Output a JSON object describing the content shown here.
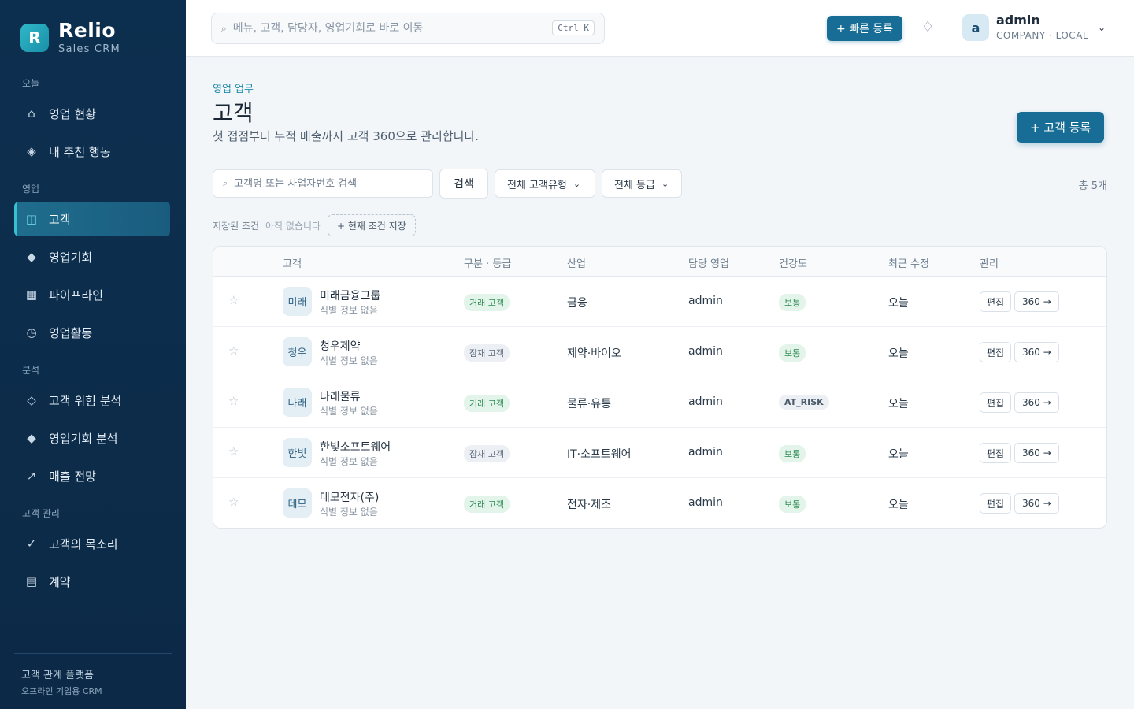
{
  "brand": {
    "logo": "R",
    "name": "Relio",
    "sub": "Sales CRM"
  },
  "sidebar": {
    "sections": [
      "오늘",
      "영업",
      "분석",
      "고객 관리"
    ],
    "items": [
      {
        "label": "영업 현황",
        "icon": "⌂"
      },
      {
        "label": "내 추천 행동",
        "icon": "◈"
      },
      {
        "label": "고객",
        "icon": "◫"
      },
      {
        "label": "영업기회",
        "icon": "◆"
      },
      {
        "label": "파이프라인",
        "icon": "▦"
      },
      {
        "label": "영업활동",
        "icon": "◷"
      },
      {
        "label": "고객 위험 분석",
        "icon": "◇"
      },
      {
        "label": "영업기회 분석",
        "icon": "◆"
      },
      {
        "label": "매출 전망",
        "icon": "↗"
      },
      {
        "label": "고객의 목소리",
        "icon": "✓"
      },
      {
        "label": "계약",
        "icon": "▤"
      }
    ],
    "footer": {
      "line1": "고객 관계 플랫폼",
      "line2": "오프라인 기업용 CRM"
    }
  },
  "topbar": {
    "search_placeholder": "메뉴, 고객, 담당자, 영업기회로 바로 이동",
    "search_icon": "⌕",
    "shortcut": "Ctrl K",
    "quick_add": "+ 빠른 등록",
    "bell_icon": "♢",
    "user": {
      "initial": "a",
      "name": "admin",
      "org": "COMPANY · LOCAL",
      "chevron": "⌄"
    }
  },
  "page": {
    "breadcrumb": "영업 업무",
    "title": "고객",
    "description": "첫 접점부터 누적 매출까지 고객 360으로 관리합니다.",
    "add_button": "+ 고객 등록"
  },
  "filters": {
    "search_placeholder": "고객명 또는 사업자번호 검색",
    "search_icon": "⌕",
    "search_button": "검색",
    "type_select": "전체 고객유형",
    "grade_select": "전체 등급",
    "chevron": "⌄",
    "total": "총 5개"
  },
  "saved": {
    "label": "저장된 조건",
    "empty": "아직 없습니다",
    "save_button": "+ 현재 조건 저장"
  },
  "table": {
    "headers": [
      "고객",
      "구분 · 등급",
      "산업",
      "담당 영업",
      "건강도",
      "최근 수정",
      "관리"
    ],
    "star": "☆",
    "edit_label": "편집",
    "view_label": "360 →",
    "rows": [
      {
        "avatar": "미래",
        "name": "미래금융그룹",
        "sub": "식별 정보 없음",
        "type": "거래 고객",
        "industry": "금융",
        "owner": "admin",
        "health": "보통",
        "updated": "오늘"
      },
      {
        "avatar": "청우",
        "name": "청우제약",
        "sub": "식별 정보 없음",
        "type": "잠재 고객",
        "industry": "제약·바이오",
        "owner": "admin",
        "health": "보통",
        "updated": "오늘"
      },
      {
        "avatar": "나래",
        "name": "나래물류",
        "sub": "식별 정보 없음",
        "type": "거래 고객",
        "industry": "물류·유통",
        "owner": "admin",
        "health": "AT_RISK",
        "updated": "오늘"
      },
      {
        "avatar": "한빛",
        "name": "한빛소프트웨어",
        "sub": "식별 정보 없음",
        "type": "잠재 고객",
        "industry": "IT·소프트웨어",
        "owner": "admin",
        "health": "보통",
        "updated": "오늘"
      },
      {
        "avatar": "데모",
        "name": "데모전자(주)",
        "sub": "식별 정보 없음",
        "type": "거래 고객",
        "industry": "전자·제조",
        "owner": "admin",
        "health": "보통",
        "updated": "오늘"
      }
    ]
  }
}
